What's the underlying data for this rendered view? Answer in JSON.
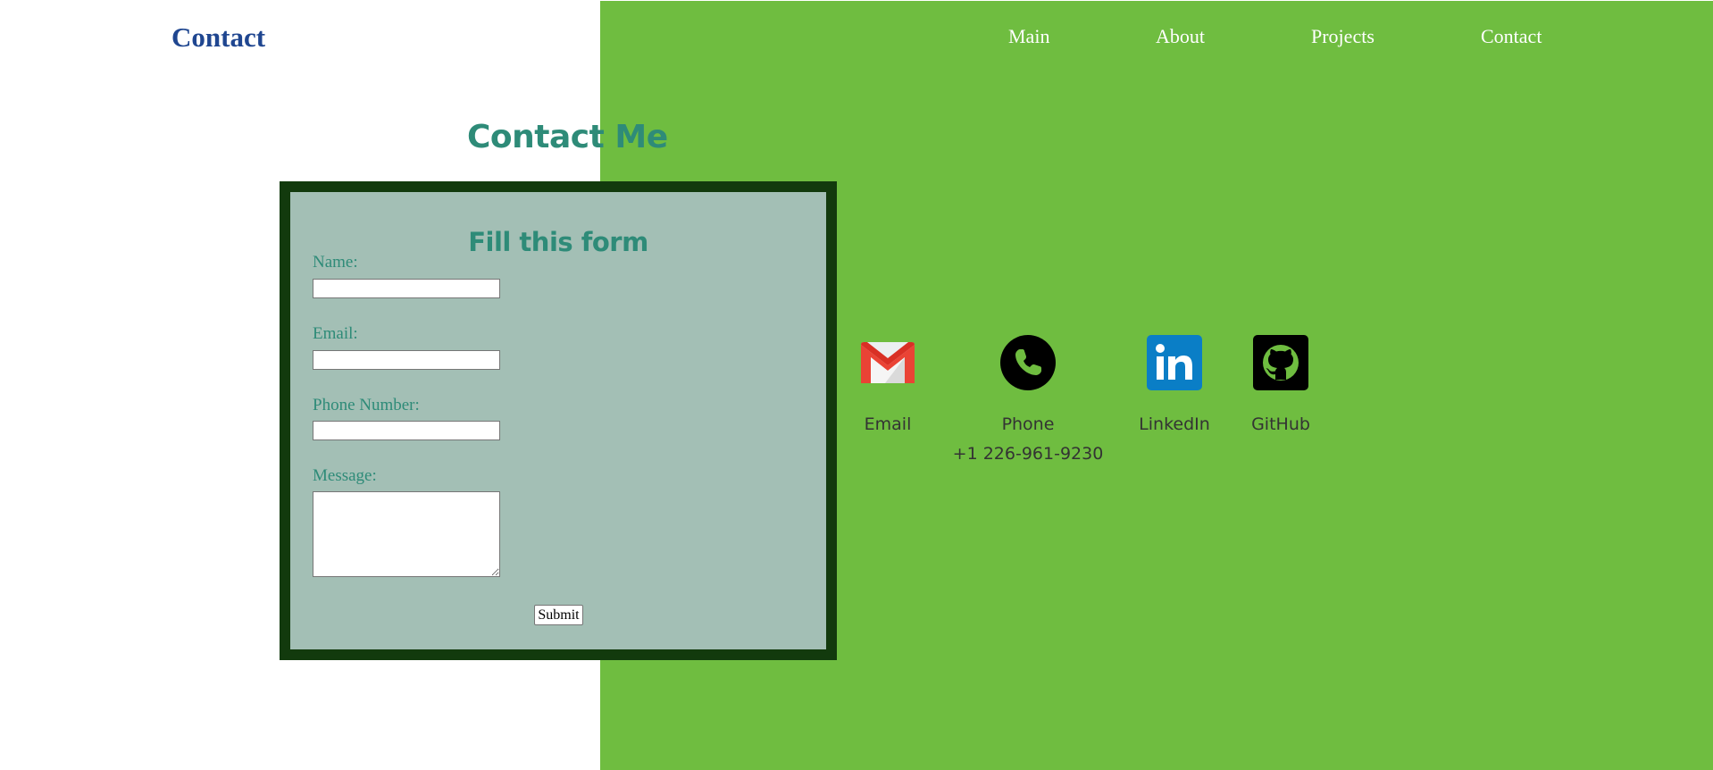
{
  "header": {
    "site_title": "Contact",
    "nav": [
      {
        "label": "Main"
      },
      {
        "label": "About"
      },
      {
        "label": "Projects"
      },
      {
        "label": "Contact"
      }
    ]
  },
  "main": {
    "heading": "Contact Me",
    "form": {
      "title": "Fill this form",
      "fields": {
        "name": {
          "label": "Name:",
          "value": "",
          "placeholder": ""
        },
        "email": {
          "label": "Email:",
          "value": "",
          "placeholder": ""
        },
        "phone": {
          "label": "Phone Number:",
          "value": "",
          "placeholder": ""
        },
        "message": {
          "label": "Message:",
          "value": "",
          "placeholder": ""
        }
      },
      "submit_label": "Submit"
    },
    "contacts": [
      {
        "label": "Email",
        "icon": "gmail-icon"
      },
      {
        "label": "Phone",
        "icon": "phone-icon",
        "detail": "+1 226-961-9230"
      },
      {
        "label": "LinkedIn",
        "icon": "linkedin-icon"
      },
      {
        "label": "GitHub",
        "icon": "github-icon"
      }
    ]
  },
  "colors": {
    "page_background": "#ffffff",
    "green_panel": "#6fbd40",
    "site_title": "#1f4690",
    "heading_teal": "#2e8b78",
    "form_background": "#a3bfb5",
    "form_border": "#123a0d",
    "nav_text": "#ffffff"
  }
}
